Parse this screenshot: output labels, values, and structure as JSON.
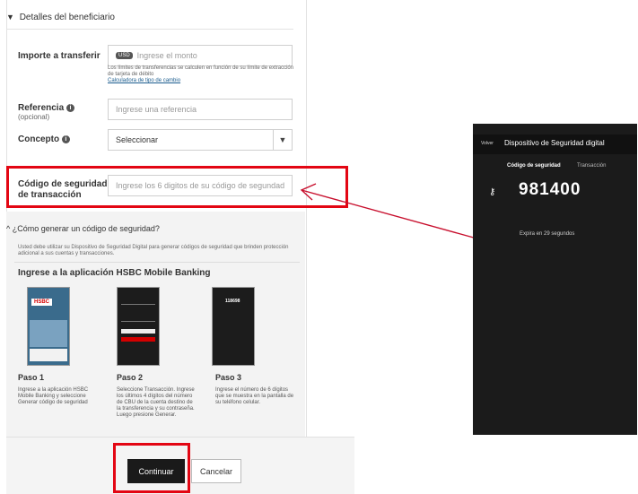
{
  "form": {
    "section_title": "Detalles del beneficiario",
    "amount": {
      "label": "Importe a transferir",
      "currency": "USD",
      "placeholder": "Ingrese el monto"
    },
    "limits_note": "Los límites de transferencias se calculen en función de su límite de extracción de tarjeta de débito",
    "limits_link": "Calculadora de tipo de cambio",
    "reference": {
      "label": "Referencia",
      "sublabel": "(opcional)",
      "placeholder": "Ingrese una referencia"
    },
    "concept": {
      "label": "Concepto",
      "value": "Seleccionar"
    },
    "security_code": {
      "label_line1": "Código de seguridad",
      "label_line2": "de transacción",
      "placeholder": "Ingrese los 6 digitos de su código de segundad"
    }
  },
  "howto": {
    "title": "¿Cómo generar un código de seguridad?",
    "description": "Usted debe utilizar su Dispositivo de Seguridad Digital para generar códigos de seguridad que brinden protección adicional a sus cuentas y transacciones.",
    "app_title": "Ingrese a la aplicación HSBC Mobile Banking",
    "steps": [
      {
        "title": "Paso 1",
        "desc": "Ingrese a la aplicación HSBC Mobile Banking y seleccione Generar código de seguridad"
      },
      {
        "title": "Paso 2",
        "desc": "Seleccione Transacción. Ingrese los últimos 4 dígitos del número de CBU de la cuenta destino de la transferencia y su contraseña. Luego presione Generar."
      },
      {
        "title": "Paso 3",
        "desc": "Ingrese el número de 6 dígitos que se muestra en la pantalla de su teléfono celular."
      }
    ],
    "phone1_brand": "HSBC",
    "phone3_code": "118698"
  },
  "actions": {
    "continue": "Continuar",
    "cancel": "Cancelar"
  },
  "device": {
    "back": "Volver",
    "title": "Dispositivo de Seguridad digital",
    "tab_active": "Código de seguridad",
    "tab_other": "Transacción",
    "code": "981400",
    "expiry": "Expira en 29 segundos"
  },
  "colors": {
    "highlight": "#e30613",
    "primary_button": "#1a1a1a",
    "device_bg": "#1b1b1b"
  }
}
